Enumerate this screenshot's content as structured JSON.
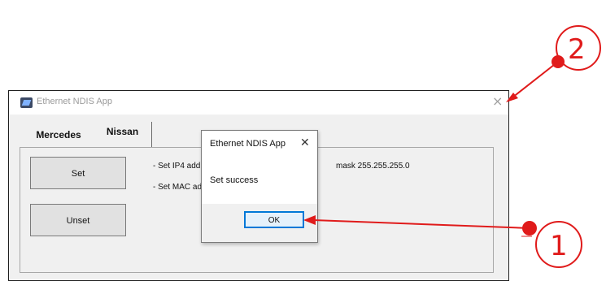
{
  "window": {
    "title": "Ethernet NDIS App",
    "close_glyph": "×"
  },
  "tabs": [
    {
      "label": "Mercedes",
      "selected": false
    },
    {
      "label": "Nissan",
      "selected": true
    }
  ],
  "buttons": {
    "set_label": "Set",
    "unset_label": "Unset"
  },
  "info_lines": {
    "line1_start": "- Set IP4 add",
    "line1_end": "mask 255.255.255.0",
    "line2_start": "- Set MAC ad"
  },
  "dialog": {
    "title": "Ethernet NDIS App",
    "close_glyph": "✕",
    "message": "Set success",
    "ok_label": "OK"
  },
  "annotations": {
    "callout_1": "1",
    "callout_2": "2",
    "color": "#e01b1b"
  },
  "icons": {
    "app_icon": "app-logo-icon",
    "close": "close-icon"
  }
}
